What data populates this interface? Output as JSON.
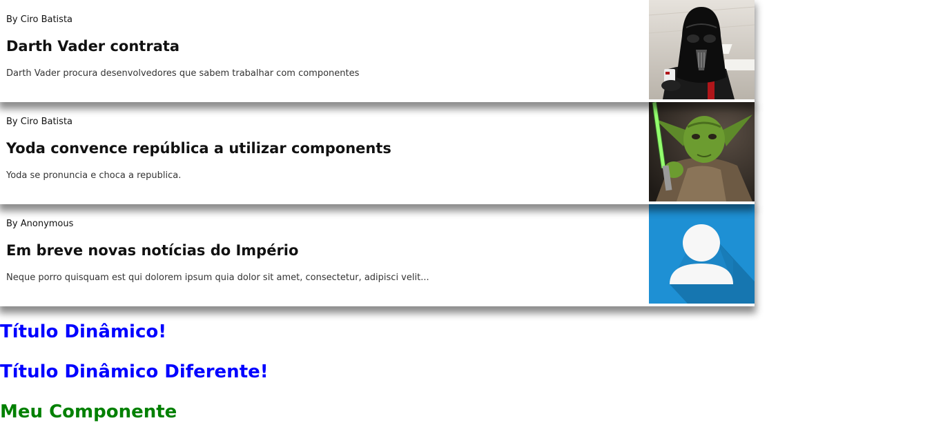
{
  "news": [
    {
      "author": "By Ciro Batista",
      "title": "Darth Vader contrata",
      "description": "Darth Vader procura desenvolvedores que sabem trabalhar com componentes",
      "image": "darth-vader-photo"
    },
    {
      "author": "By Ciro Batista",
      "title": "Yoda convence república a utilizar components",
      "description": "Yoda se pronuncia e choca a republica.",
      "image": "yoda-photo"
    },
    {
      "author": "By Anonymous",
      "title": "Em breve novas notícias do Império",
      "description": "Neque porro quisquam est qui dolorem ipsum quia dolor sit amet, consectetur, adipisci velit...",
      "image": "user-avatar-icon"
    }
  ],
  "headings": {
    "dynamic_title": "Título Dinâmico!",
    "dynamic_title_alt": "Título Dinâmico Diferente!",
    "my_component": "Meu Componente"
  },
  "colors": {
    "dynamic_title": "#0000ff",
    "my_component": "#008000",
    "avatar_bg": "#1e90d4"
  }
}
